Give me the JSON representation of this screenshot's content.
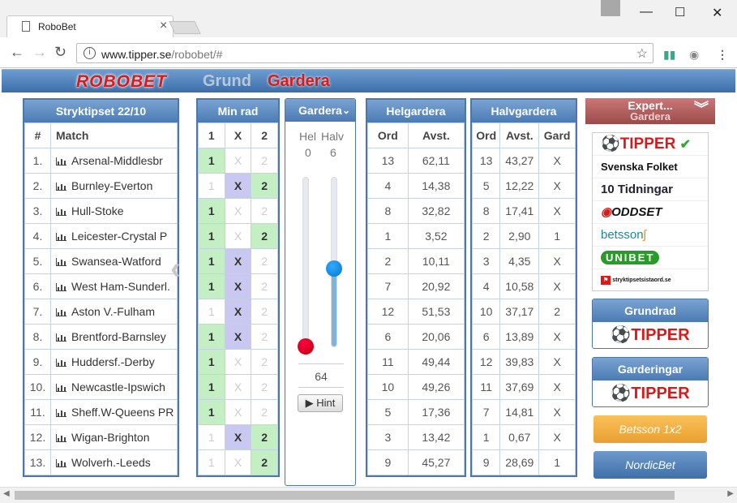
{
  "browser": {
    "tab_title": "RoboBet",
    "url_host": "www.tipper.se",
    "url_path": "/robobet/#",
    "minimize": "—",
    "maximize": "☐",
    "close": "✕"
  },
  "nav": {
    "logo": "ROBOBET",
    "grund": "Grund",
    "gardera": "Gardera"
  },
  "match_panel": {
    "title": "Stryktipset 22/10",
    "col_num": "#",
    "col_match": "Match",
    "rows": [
      {
        "n": "1.",
        "m": "Arsenal-Middlesbr"
      },
      {
        "n": "2.",
        "m": "Burnley-Everton"
      },
      {
        "n": "3.",
        "m": "Hull-Stoke"
      },
      {
        "n": "4.",
        "m": "Leicester-Crystal P"
      },
      {
        "n": "5.",
        "m": "Swansea-Watford"
      },
      {
        "n": "6.",
        "m": "West Ham-Sunderl."
      },
      {
        "n": "7.",
        "m": "Aston V.-Fulham"
      },
      {
        "n": "8.",
        "m": "Brentford-Barnsley"
      },
      {
        "n": "9.",
        "m": "Huddersf.-Derby"
      },
      {
        "n": "10.",
        "m": "Newcastle-Ipswich"
      },
      {
        "n": "11.",
        "m": "Sheff.W-Queens PR"
      },
      {
        "n": "12.",
        "m": "Wigan-Brighton"
      },
      {
        "n": "13.",
        "m": "Wolverh.-Leeds"
      }
    ]
  },
  "minrad": {
    "title": "Min rad",
    "cols": [
      "1",
      "X",
      "2"
    ],
    "rows": [
      [
        "1",
        "",
        "2off"
      ],
      [
        "1off",
        "X",
        "2"
      ],
      [
        "1",
        "",
        "2off"
      ],
      [
        "1",
        "",
        "2"
      ],
      [
        "1",
        "X",
        "2off"
      ],
      [
        "1",
        "X",
        "2off"
      ],
      [
        "1off",
        "X",
        "2off"
      ],
      [
        "1",
        "X",
        "2off"
      ],
      [
        "1",
        "",
        "2off"
      ],
      [
        "1",
        "",
        "2off"
      ],
      [
        "1",
        "",
        "2off"
      ],
      [
        "1off",
        "X",
        "2"
      ],
      [
        "1off",
        "",
        "2"
      ]
    ]
  },
  "gardera": {
    "title": "Gardera",
    "hel_label": "Hel",
    "halv_label": "Halv",
    "hel_value": "0",
    "halv_value": "6",
    "sum": "64",
    "hint": "Hint"
  },
  "helgardera": {
    "title": "Helgardera",
    "col_ord": "Ord",
    "col_avst": "Avst.",
    "rows": [
      [
        "13",
        "62,11"
      ],
      [
        "4",
        "14,38"
      ],
      [
        "8",
        "32,82"
      ],
      [
        "1",
        "3,52"
      ],
      [
        "2",
        "10,11"
      ],
      [
        "7",
        "20,92"
      ],
      [
        "12",
        "51,53"
      ],
      [
        "6",
        "20,06"
      ],
      [
        "11",
        "49,44"
      ],
      [
        "10",
        "49,26"
      ],
      [
        "5",
        "17,36"
      ],
      [
        "3",
        "13,42"
      ],
      [
        "9",
        "45,27"
      ]
    ]
  },
  "halvgardera": {
    "title": "Halvgardera",
    "col_ord": "Ord",
    "col_avst": "Avst.",
    "col_gard": "Gard",
    "rows": [
      [
        "13",
        "43,27",
        "X"
      ],
      [
        "5",
        "12,22",
        "X"
      ],
      [
        "8",
        "17,41",
        "X"
      ],
      [
        "2",
        "2,90",
        "1"
      ],
      [
        "3",
        "4,35",
        "X"
      ],
      [
        "4",
        "10,58",
        "X"
      ],
      [
        "10",
        "37,17",
        "2"
      ],
      [
        "6",
        "13,89",
        "X"
      ],
      [
        "12",
        "39,83",
        "X"
      ],
      [
        "11",
        "37,69",
        "X"
      ],
      [
        "7",
        "14,81",
        "X"
      ],
      [
        "1",
        "0,67",
        "X"
      ],
      [
        "9",
        "28,69",
        "1"
      ]
    ]
  },
  "sidebar": {
    "expert": "Expert...",
    "expert_sub": "Gardera",
    "brands": [
      "TIPPER",
      "Svenska Folket",
      "10 Tidningar",
      "ODDSET",
      "betsson",
      "UNIBET",
      "stryktipsetsistaord.se"
    ],
    "grundrad": "Grundrad",
    "grundrad_brand": "TIPPER",
    "garderingar": "Garderingar",
    "garderingar_brand": "TIPPER",
    "betsson_btn": "Betsson 1x2",
    "nordic_btn": "NordicBet"
  },
  "colors": {
    "accent_blue": "#4b7bb4",
    "one_green": "#c4efc4",
    "x_purple": "#c8c8f0",
    "brand_red": "#d81a1a"
  }
}
